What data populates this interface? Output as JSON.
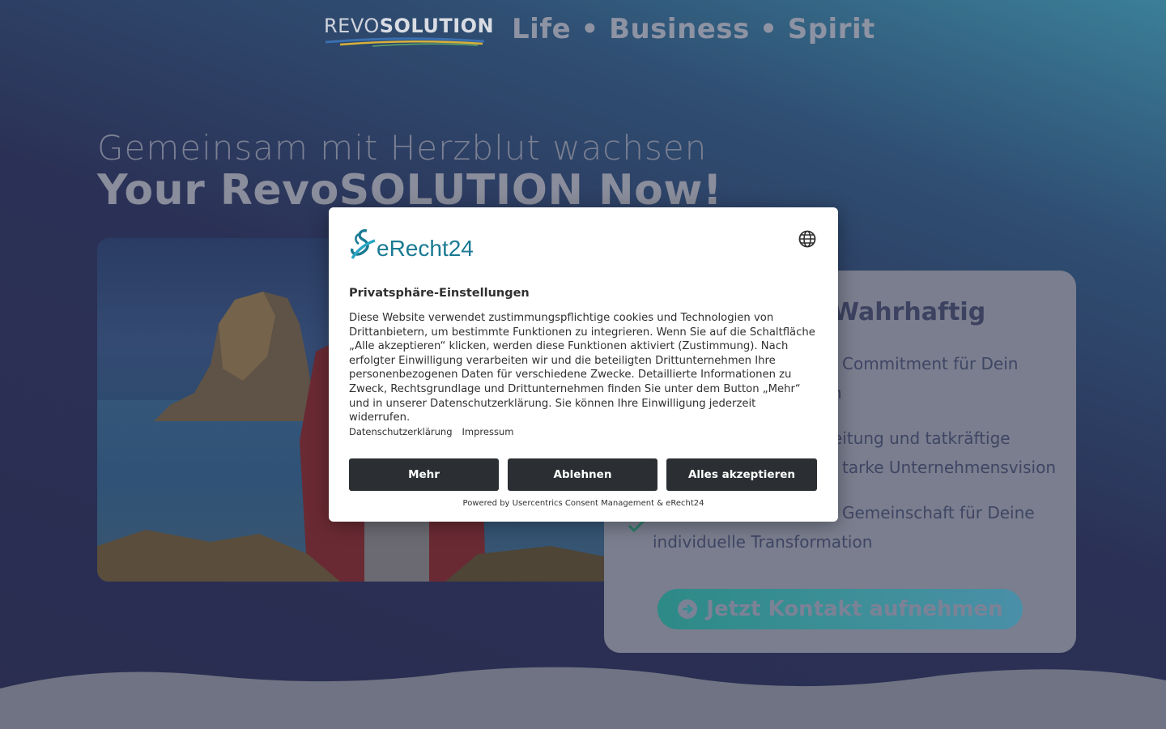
{
  "header": {
    "logo_prefix": "REVO",
    "logo_suffix": "SOLUTION",
    "tagline": "Life • Business • Spirit"
  },
  "hero": {
    "subtitle": "Gemeinsam mit Herzblut wachsen",
    "title": "Your RevoSOLUTION Now!"
  },
  "card": {
    "title": "Wahrhaftig",
    "items": [
      "Commitment für Dein",
      "n",
      "eitung und tatkräftige",
      "tarke Unternehmensvision",
      "Gemeinschaft für Deine",
      "individuelle Transformation"
    ],
    "cta_label": "Jetzt Kontakt aufnehmen"
  },
  "consent": {
    "brand": "eRecht24",
    "title": "Privatsphäre-Einstellungen",
    "body": "Diese Website verwendet zustimmungspflichtige cookies und Technologien von Drittanbietern, um bestimmte Funktionen zu integrieren. Wenn Sie auf die Schaltfläche „Alle akzeptieren“ klicken, werden diese Funktionen aktiviert (Zustimmung). Nach erfolgter Einwilligung verarbeiten wir und die beteiligten Drittunternehmen Ihre personenbezogenen Daten für verschiedene Zwecke. Detaillierte Informationen zu Zweck, Rechtsgrundlage und Drittunternehmen finden Sie unter dem Button „Mehr“ und in unserer Datenschutzerklärung. Sie können Ihre Einwilligung jederzeit widerrufen.",
    "links": {
      "privacy": "Datenschutzerklärung",
      "imprint": "Impressum"
    },
    "buttons": {
      "more": "Mehr",
      "deny": "Ablehnen",
      "accept": "Alles akzeptieren"
    },
    "powered_by": "Powered by Usercentrics Consent Management & eRecht24"
  },
  "colors": {
    "accent": "#1a7a93",
    "button_dark": "#2b2f33",
    "page_bg": "#2a2d50"
  }
}
